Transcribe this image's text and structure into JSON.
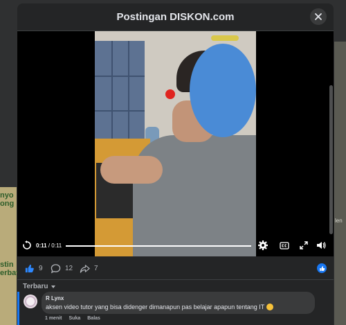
{
  "background": {
    "left_snippets": [
      "nyo",
      "ong",
      "stin",
      "erbay"
    ],
    "right_snippet": "len"
  },
  "modal": {
    "title": "Postingan DISKON.com",
    "close_icon": "close-icon"
  },
  "video": {
    "current_time": "0:11",
    "separator": "/",
    "duration": "0:11",
    "progress_fraction": 1.0,
    "icons": [
      "replay-icon",
      "settings-icon",
      "captions-icon",
      "fullscreen-icon",
      "volume-icon"
    ]
  },
  "engagement": {
    "likes": "9",
    "comments": "12",
    "shares": "7",
    "icons": [
      "like-icon",
      "comment-icon",
      "share-icon"
    ],
    "accent": "#1877f2"
  },
  "comments": {
    "sort_label": "Terbaru",
    "items": [
      {
        "author": "R Lynx",
        "text": "aksen video tutor yang bisa didenger dimanapun pas belajar apapun tentang IT",
        "time": "1 menit",
        "like_label": "Suka",
        "reply_label": "Balas"
      }
    ]
  }
}
